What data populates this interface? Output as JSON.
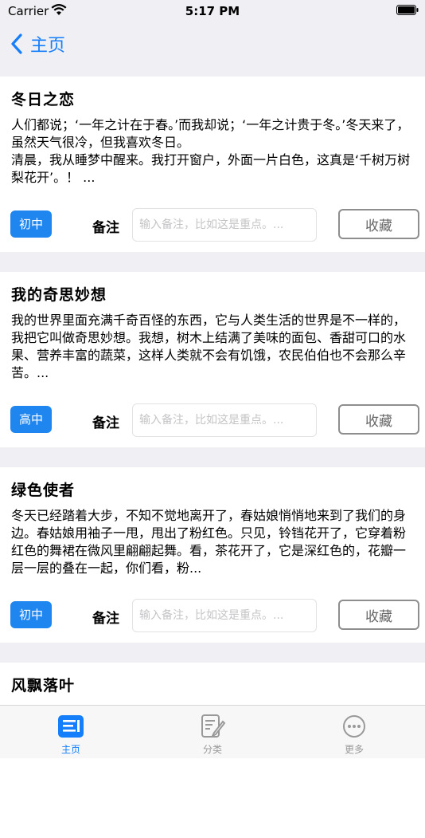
{
  "status_bar": {
    "carrier": "Carrier",
    "time": "5:17 PM"
  },
  "nav": {
    "back_label": "主页"
  },
  "note_label": "备注",
  "note_placeholder": "输入备注，比如这是重点。...",
  "fav_label": "收藏",
  "cards": [
    {
      "title": "冬日之恋",
      "excerpt": "人们都说；‘一年之计在于春。’而我却说；‘一年之计贵于冬。’冬天来了，虽然天气很冷，但我喜欢冬日。\n清晨，我从睡梦中醒来。我打开窗户，外面一片白色，这真是‘千树万树梨花开’。！ ...",
      "grade": "初中"
    },
    {
      "title": "我的奇思妙想",
      "excerpt": "我的世界里面充满千奇百怪的东西，它与人类生活的世界是不一样的，我把它叫做奇思妙想。我想，树木上结满了美味的面包、香甜可口的水果、营养丰富的蔬菜，这样人类就不会有饥饿，农民伯伯也不会那么辛苦。...",
      "grade": "高中"
    },
    {
      "title": "绿色使者",
      "excerpt": "冬天已经踏着大步，不知不觉地离开了，春姑娘悄悄地来到了我们的身边。春姑娘用袖子一甩，甩出了粉红色。只见，铃铛花开了，它穿着粉红色的舞裙在微风里翩翩起舞。看，茶花开了，它是深红色的，花瓣一层一层的叠在一起，你们看，粉...",
      "grade": "初中"
    },
    {
      "title": "风飘落叶",
      "excerpt": "...",
      "grade": ""
    }
  ],
  "tabs": [
    {
      "label": "主页",
      "icon": "home-list-icon",
      "active": true
    },
    {
      "label": "分类",
      "icon": "category-edit-icon",
      "active": false
    },
    {
      "label": "更多",
      "icon": "more-icon",
      "active": false
    }
  ],
  "colors": {
    "accent": "#147efb",
    "grade_badge": "#1f86f0",
    "background": "#efeff4"
  }
}
